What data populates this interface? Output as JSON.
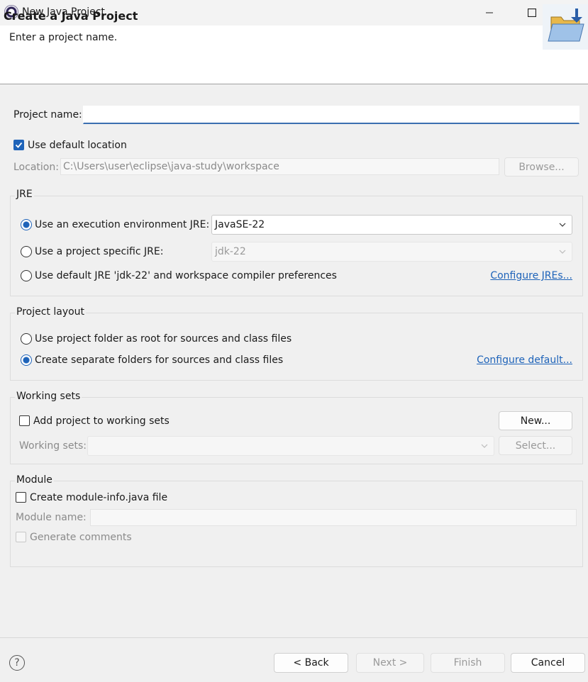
{
  "window": {
    "title": "New Java Project",
    "controls": {
      "minimize": "minimize-icon",
      "maximize": "maximize-icon",
      "close": "close-icon"
    }
  },
  "banner": {
    "title": "Create a Java Project",
    "subtitle": "Enter a project name.",
    "icon": "folder-icon"
  },
  "project": {
    "name_label": "Project name:",
    "name_value": "",
    "use_default_location_label": "Use default location",
    "use_default_location_checked": true,
    "location_label": "Location:",
    "location_value": "C:\\Users\\user\\eclipse\\java-study\\workspace",
    "browse_label": "Browse..."
  },
  "jre": {
    "group_title": "JRE",
    "option_env_label": "Use an execution environment JRE:",
    "option_env_value": "JavaSE-22",
    "option_specific_label": "Use a project specific JRE:",
    "option_specific_value": "jdk-22",
    "option_default_label": "Use default JRE 'jdk-22' and workspace compiler preferences",
    "configure_link": "Configure JREs...",
    "selected": "env"
  },
  "layout": {
    "group_title": "Project layout",
    "option_root_label": "Use project folder as root for sources and class files",
    "option_separate_label": "Create separate folders for sources and class files",
    "configure_link": "Configure default...",
    "selected": "separate"
  },
  "working_sets": {
    "group_title": "Working sets",
    "add_label": "Add project to working sets",
    "add_checked": false,
    "new_button": "New...",
    "sets_label": "Working sets:",
    "select_button": "Select..."
  },
  "module": {
    "group_title": "Module",
    "create_label": "Create module-info.java file",
    "create_checked": false,
    "name_label": "Module name:",
    "generate_label": "Generate comments"
  },
  "footer": {
    "help_icon": "help-icon",
    "help_glyph": "?",
    "back_button": "< Back",
    "next_button": "Next >",
    "finish_button": "Finish",
    "cancel_button": "Cancel"
  },
  "colors": {
    "accent": "#1e63b9",
    "banner_bg": "#ffffff",
    "dialog_bg": "#f0f0f0"
  }
}
